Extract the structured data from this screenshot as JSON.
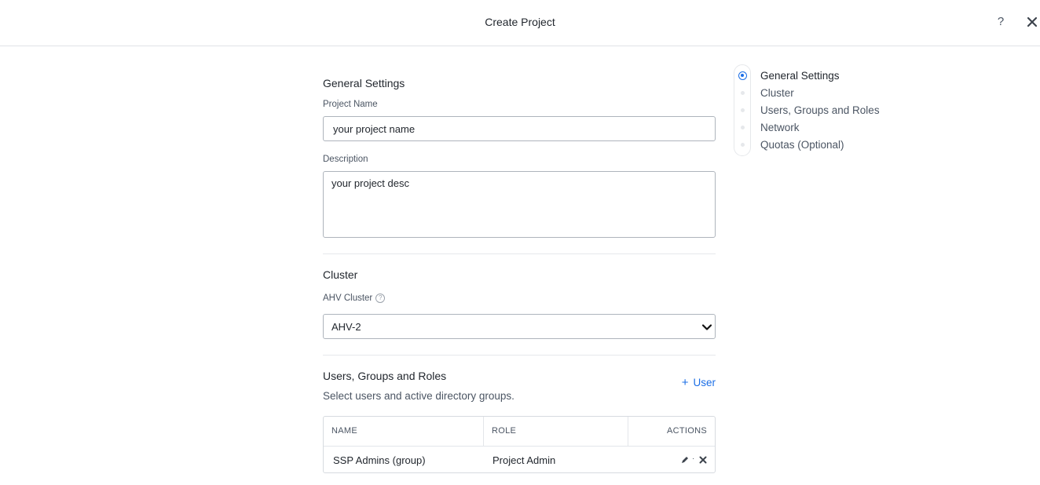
{
  "header": {
    "title": "Create Project",
    "help_label": "?"
  },
  "general": {
    "title": "General Settings",
    "project_name_label": "Project Name",
    "project_name_value": "your project name",
    "description_label": "Description",
    "description_value": "your project desc"
  },
  "cluster": {
    "title": "Cluster",
    "ahv_label": "AHV Cluster",
    "help_mark": "?",
    "selected": "AHV-2"
  },
  "users": {
    "title": "Users, Groups and Roles",
    "subtitle": "Select users and active directory groups.",
    "add_plus": "+",
    "add_label": "User",
    "columns": [
      "NAME",
      "ROLE",
      "ACTIONS"
    ],
    "rows": [
      {
        "name": "SSP Admins (group)",
        "role": "Project Admin",
        "separator": "·"
      }
    ]
  },
  "steps": [
    {
      "label": "General Settings",
      "active": true
    },
    {
      "label": "Cluster",
      "active": false
    },
    {
      "label": "Users, Groups and Roles",
      "active": false
    },
    {
      "label": "Network",
      "active": false
    },
    {
      "label": "Quotas (Optional)",
      "active": false
    }
  ],
  "colors": {
    "accent": "#1b6ee6",
    "text": "#22272e",
    "muted": "#4b5563",
    "border": "#aeb4bc"
  },
  "icons": {
    "close": "close-icon",
    "help": "help-icon",
    "chevron": "chevron-down-icon",
    "edit": "pencil-icon",
    "delete": "x-icon"
  }
}
